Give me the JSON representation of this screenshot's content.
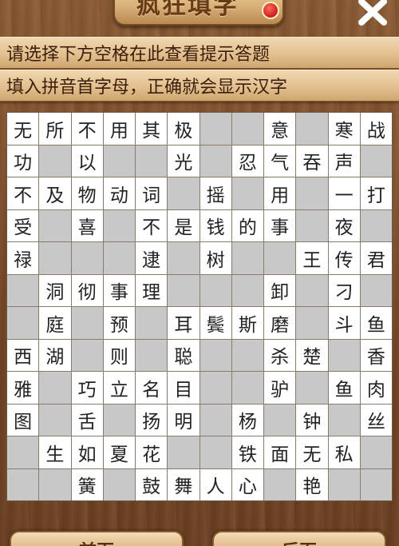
{
  "header": {
    "title": "疯狂填字"
  },
  "hints": {
    "line1": "请选择下方空格在此查看提示答题",
    "line2": "填入拼音首字母，正确就会显示汉字"
  },
  "grid": {
    "rows": 12,
    "cols": 12,
    "cells": [
      "无",
      "所",
      "不",
      "用",
      "其",
      "极",
      "",
      "",
      "意",
      "",
      "寒",
      "战",
      "功",
      "",
      "以",
      "",
      "",
      "光",
      "",
      "忍",
      "气",
      "吞",
      "声",
      "",
      "不",
      "及",
      "物",
      "动",
      "词",
      "",
      "摇",
      "",
      "用",
      "",
      "一",
      "打",
      "受",
      "",
      "喜",
      "",
      "不",
      "是",
      "钱",
      "的",
      "事",
      "",
      "夜",
      "",
      "禄",
      "",
      "",
      "",
      "逮",
      "",
      "树",
      "",
      "",
      "王",
      "传",
      "君",
      "",
      "洞",
      "彻",
      "事",
      "理",
      "",
      "",
      "",
      "卸",
      "",
      "刁",
      "",
      "",
      "庭",
      "",
      "预",
      "",
      "耳",
      "鬓",
      "斯",
      "磨",
      "",
      "斗",
      "鱼",
      "西",
      "湖",
      "",
      "则",
      "",
      "聪",
      "",
      "",
      "杀",
      "楚",
      "",
      "香",
      "雅",
      "",
      "巧",
      "立",
      "名",
      "目",
      "",
      "",
      "驴",
      "",
      "鱼",
      "肉",
      "图",
      "",
      "舌",
      "",
      "扬",
      "明",
      "",
      "杨",
      "",
      "钟",
      "",
      "丝",
      "",
      "生",
      "如",
      "夏",
      "花",
      "",
      "",
      "铁",
      "面",
      "无",
      "私",
      "",
      "",
      "",
      "簧",
      "",
      "鼓",
      "舞",
      "人",
      "心",
      "",
      "艳",
      "",
      ""
    ]
  },
  "footer": {
    "prev_label": "前页",
    "next_label": "后页"
  }
}
